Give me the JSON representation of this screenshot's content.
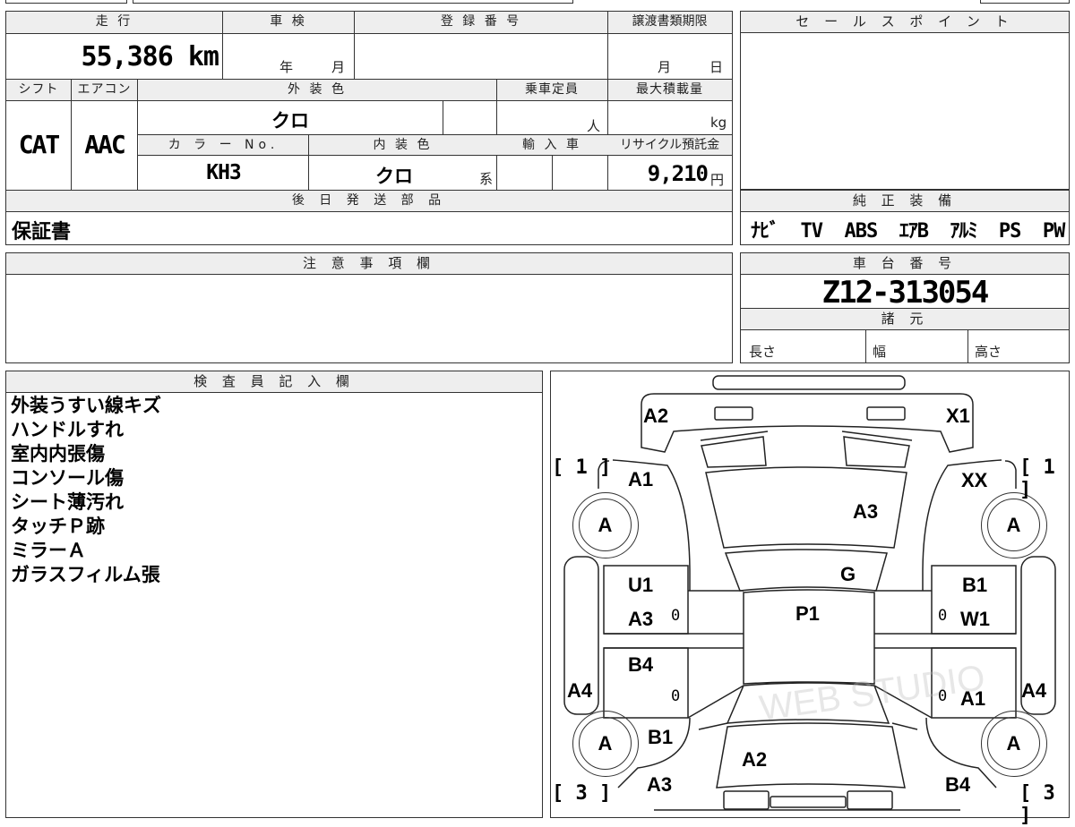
{
  "vehicle": {
    "mileage_label": "走 行",
    "mileage": "55,386 km",
    "inspection_label": "車 検",
    "inspection_year": "年",
    "inspection_month": "月",
    "registration_label": "登 録 番 号",
    "transfer_deadline_label": "譲渡書類期限",
    "transfer_month": "月",
    "transfer_day": "日",
    "shift_label": "シフト",
    "shift": "CAT",
    "ac_label": "エアコン",
    "ac": "AAC",
    "exterior_color_label": "外 装 色",
    "exterior_color": "クロ",
    "capacity_label": "乗車定員",
    "capacity_unit": "人",
    "max_load_label": "最大積載量",
    "max_load_unit": "kg",
    "color_no_label": "カ ラ ー No.",
    "color_no": "KH3",
    "interior_color_label": "内 装 色",
    "interior_color": "クロ",
    "interior_suffix": "系",
    "import_label": "輸 入 車",
    "recycle_label": "リサイクル預託金",
    "recycle_fee": "9,210",
    "recycle_unit": "円",
    "shipping_label": "後 日 発 送 部 品",
    "shipping_items": "保証書"
  },
  "sales_point": {
    "label": "セ ー ル ス ポ イ ン ト"
  },
  "genuine_equipment": {
    "label": "純 正 装 備",
    "items": "ﾅﾋﾞ  TV  ABS  ｴｱB  ｱﾙﾐ  PS  PW"
  },
  "notes": {
    "label": "注 意 事 項 欄"
  },
  "chassis": {
    "label": "車 台 番 号",
    "number": "Z12-313054",
    "specs_label": "諸 元",
    "length_label": "長さ",
    "width_label": "幅",
    "height_label": "高さ"
  },
  "inspector": {
    "label": "検 査 員 記 入 欄",
    "remarks": [
      "外装うすい線キズ",
      "ハンドルすれ",
      "室内内張傷",
      "コンソール傷",
      "シート薄汚れ",
      "タッチＰ跡",
      "ミラーＡ",
      "ガラスフィルム張"
    ]
  },
  "diagram": {
    "marks": {
      "front_left_bumper": "A2",
      "front_right_bumper": "X1",
      "front_left_fender": "A1",
      "front_right_fender": "XX",
      "hood": "A3",
      "windshield": "G",
      "roof": "P1",
      "front_left_door_1": "U1",
      "front_left_door_2": "A3",
      "front_right_door_1": "B1",
      "front_right_door_2": "W1",
      "rear_left_door": "B4",
      "rear_right_door": "A1",
      "left_sill": "A4",
      "right_sill": "A4",
      "rear_left_fender": "B1",
      "rear_left_corner": "A3",
      "trunk": "A2",
      "rear_right_corner": "B4"
    },
    "wheel_label": "A",
    "tire_front_left": "[ 1 ]",
    "tire_front_right": "[ 1 ]",
    "tire_rear_left": "[ 3 ]",
    "tire_rear_right": "[ 3 ]",
    "zero": "0"
  }
}
